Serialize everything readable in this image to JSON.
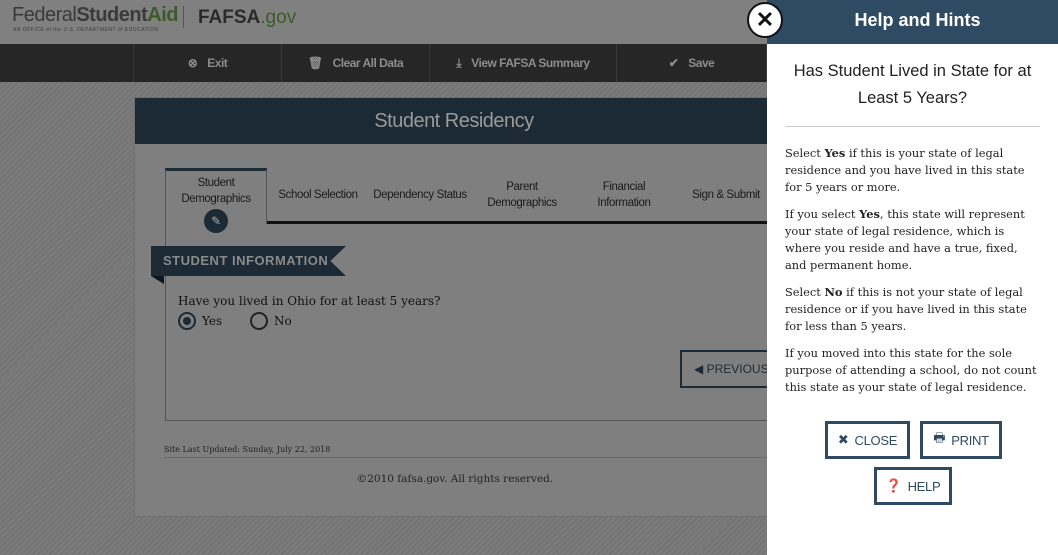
{
  "header": {
    "logo_text": "Federal Student Aid",
    "logo_sub": "AN OFFICE of the U.S. DEPARTMENT of EDUCATION",
    "site_logo": "FAFSA.gov"
  },
  "nav": [
    {
      "label": "Exit",
      "icon": "exit-circle-icon"
    },
    {
      "label": "Clear All Data",
      "icon": "trash-icon"
    },
    {
      "label": "View FAFSA Summary",
      "icon": "download-icon"
    },
    {
      "label": "Save",
      "icon": "check-icon"
    }
  ],
  "page": {
    "title": "Student Residency",
    "tabs": [
      "Student Demographics",
      "School Selection",
      "Dependency Status",
      "Parent Demographics",
      "Financial Information",
      "Sign & Submit"
    ],
    "section": "STUDENT INFORMATION",
    "question": "Have you lived in Ohio for at least 5 years?",
    "options": [
      "Yes",
      "No"
    ],
    "selected": "Yes",
    "previous": "PREVIOUS",
    "updated": "Site Last Updated: Sunday, July 22, 2018",
    "copyright": "©2010 fafsa.gov. All rights reserved."
  },
  "help": {
    "title": "Help and Hints",
    "question": "Has Student Lived in State for at Least 5 Years?",
    "close": "CLOSE",
    "print": "PRINT",
    "help": "HELP",
    "accent": "#2f4a63"
  }
}
